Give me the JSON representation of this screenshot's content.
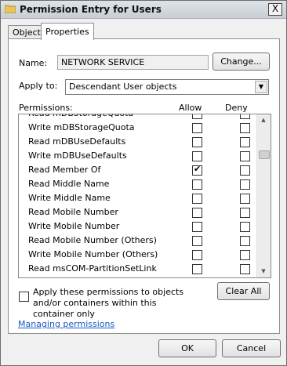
{
  "window": {
    "title": "Permission Entry for Users",
    "close_glyph": "X"
  },
  "tabs": [
    {
      "label": "Object"
    },
    {
      "label": "Properties",
      "active": true
    }
  ],
  "name_label": "Name:",
  "name_value": "NETWORK SERVICE",
  "change_button": "Change...",
  "apply_to_label": "Apply to:",
  "apply_to_value": "Descendant User objects",
  "permissions_label": "Permissions:",
  "allow_header": "Allow",
  "deny_header": "Deny",
  "permissions": [
    {
      "name": "Read mDBStorageQuota",
      "allow": false,
      "deny": false
    },
    {
      "name": "Write mDBStorageQuota",
      "allow": false,
      "deny": false
    },
    {
      "name": "Read mDBUseDefaults",
      "allow": false,
      "deny": false
    },
    {
      "name": "Write mDBUseDefaults",
      "allow": false,
      "deny": false
    },
    {
      "name": "Read Member Of",
      "allow": true,
      "deny": false
    },
    {
      "name": "Read Middle Name",
      "allow": false,
      "deny": false
    },
    {
      "name": "Write Middle Name",
      "allow": false,
      "deny": false
    },
    {
      "name": "Read Mobile Number",
      "allow": false,
      "deny": false
    },
    {
      "name": "Write Mobile Number",
      "allow": false,
      "deny": false
    },
    {
      "name": "Read Mobile Number (Others)",
      "allow": false,
      "deny": false
    },
    {
      "name": "Write Mobile Number (Others)",
      "allow": false,
      "deny": false
    },
    {
      "name": "Read msCOM-PartitionSetLink",
      "allow": false,
      "deny": false
    }
  ],
  "apply_checkbox_label": "Apply these permissions to objects and/or containers within this container only",
  "apply_checkbox_checked": false,
  "clear_all_button": "Clear All",
  "managing_link": "Managing permissions",
  "ok_button": "OK",
  "cancel_button": "Cancel",
  "icons": {
    "title": "folder-icon",
    "dropdown": "chevron-down-icon",
    "scroll_up": "scroll-up-icon",
    "scroll_down": "scroll-down-icon"
  }
}
